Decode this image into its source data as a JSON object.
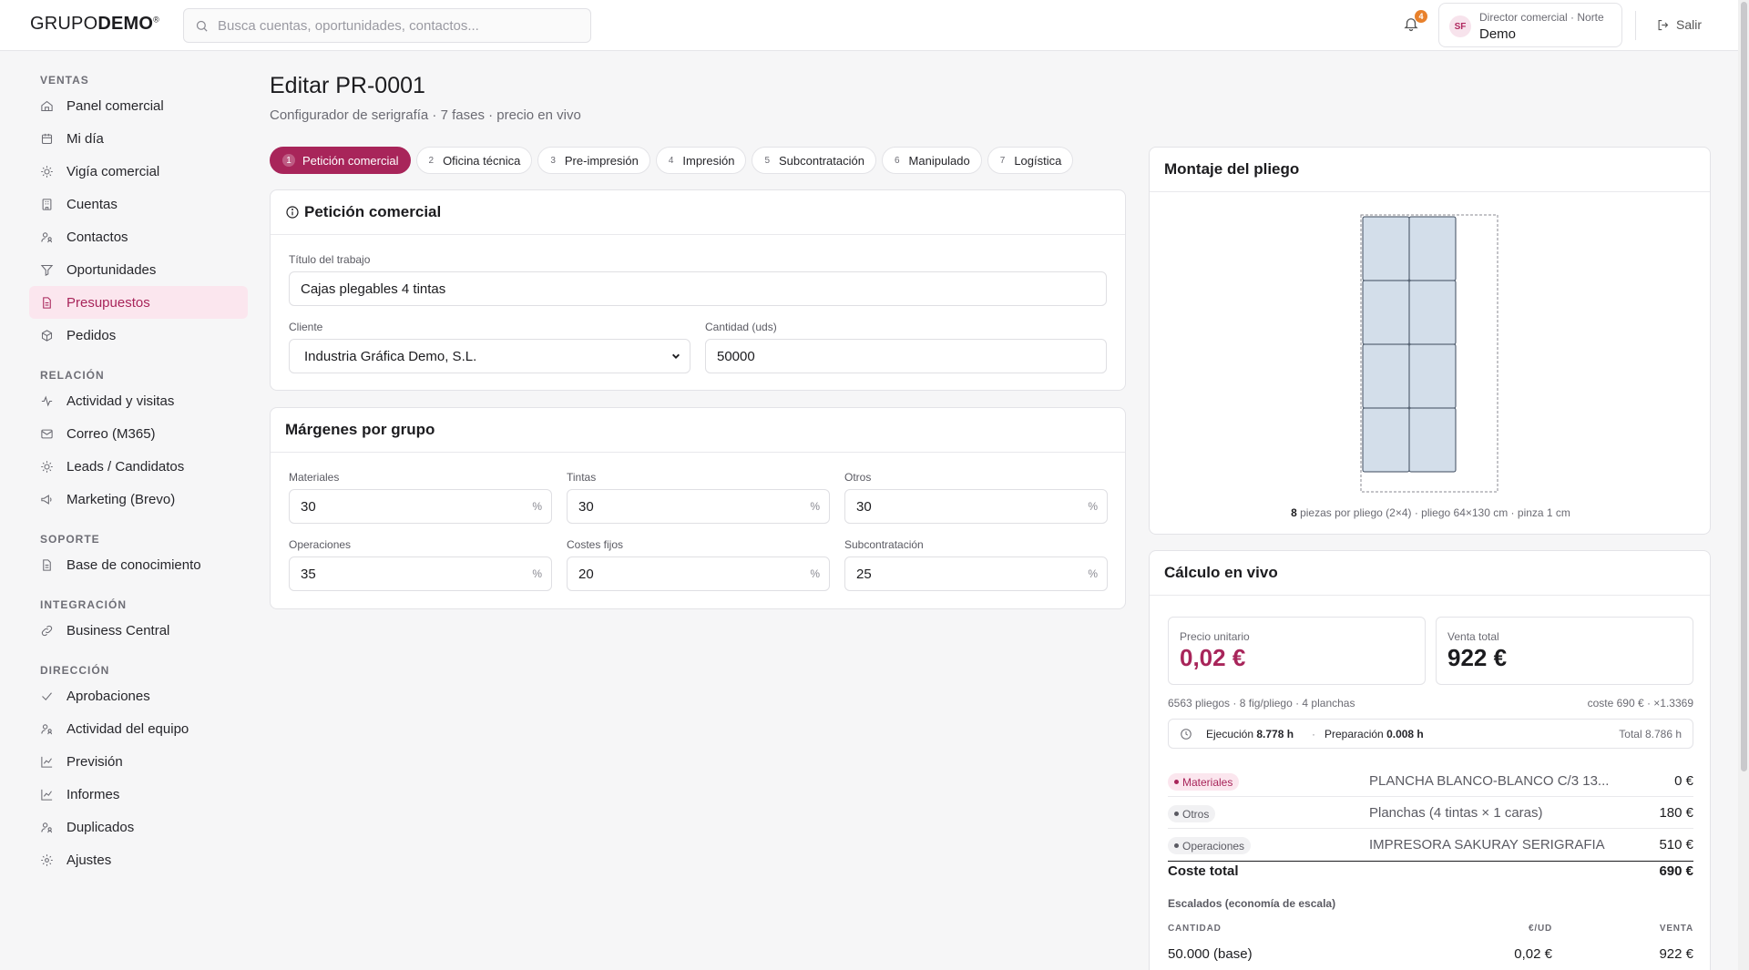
{
  "brand": {
    "logo_light": "GRUPO",
    "logo_bold": "DEMO",
    "logo_mark": "®"
  },
  "search": {
    "placeholder": "Busca cuentas, oportunidades, contactos..."
  },
  "notifications": {
    "count": "4"
  },
  "user": {
    "initials": "SF",
    "role": "Director comercial · Norte",
    "name": "Demo"
  },
  "logout_label": "Salir",
  "sidebar": {
    "sections": [
      {
        "title": "VENTAS",
        "items": [
          {
            "label": "Panel comercial",
            "icon": "home-icon"
          },
          {
            "label": "Mi día",
            "icon": "calendar-icon"
          },
          {
            "label": "Vigía comercial",
            "icon": "sun-icon"
          },
          {
            "label": "Cuentas",
            "icon": "building-icon"
          },
          {
            "label": "Contactos",
            "icon": "contacts-icon"
          },
          {
            "label": "Oportunidades",
            "icon": "funnel-icon"
          },
          {
            "label": "Presupuestos",
            "icon": "document-icon",
            "active": true
          },
          {
            "label": "Pedidos",
            "icon": "box-icon"
          }
        ]
      },
      {
        "title": "RELACIÓN",
        "items": [
          {
            "label": "Actividad y visitas",
            "icon": "activity-icon"
          },
          {
            "label": "Correo (M365)",
            "icon": "mail-icon"
          },
          {
            "label": "Leads / Candidatos",
            "icon": "sun-icon"
          },
          {
            "label": "Marketing (Brevo)",
            "icon": "megaphone-icon"
          }
        ]
      },
      {
        "title": "SOPORTE",
        "items": [
          {
            "label": "Base de conocimiento",
            "icon": "document-icon"
          }
        ]
      },
      {
        "title": "INTEGRACIÓN",
        "items": [
          {
            "label": "Business Central",
            "icon": "link-icon"
          }
        ]
      },
      {
        "title": "DIRECCIÓN",
        "items": [
          {
            "label": "Aprobaciones",
            "icon": "check-icon"
          },
          {
            "label": "Actividad del equipo",
            "icon": "contacts-icon"
          },
          {
            "label": "Previsión",
            "icon": "chart-icon"
          },
          {
            "label": "Informes",
            "icon": "chart-icon"
          },
          {
            "label": "Duplicados",
            "icon": "contacts-icon"
          },
          {
            "label": "Ajustes",
            "icon": "gear-icon"
          }
        ]
      }
    ]
  },
  "page": {
    "title": "Editar PR-0001",
    "subtitle": "Configurador de serigrafía · 7 fases · precio en vivo"
  },
  "steps": [
    {
      "num": "1",
      "label": "Petición comercial",
      "active": true
    },
    {
      "num": "2",
      "label": "Oficina técnica"
    },
    {
      "num": "3",
      "label": "Pre-impresión"
    },
    {
      "num": "4",
      "label": "Impresión"
    },
    {
      "num": "5",
      "label": "Subcontratación"
    },
    {
      "num": "6",
      "label": "Manipulado"
    },
    {
      "num": "7",
      "label": "Logística"
    }
  ],
  "request": {
    "heading": "Petición comercial",
    "title_label": "Título del trabajo",
    "title_value": "Cajas plegables 4 tintas",
    "client_label": "Cliente",
    "client_value": "Industria Gráfica Demo, S.L.",
    "qty_label": "Cantidad (uds)",
    "qty_value": "50000"
  },
  "margins": {
    "heading": "Márgenes por grupo",
    "unit": "%",
    "fields": [
      {
        "label": "Materiales",
        "value": "30"
      },
      {
        "label": "Tintas",
        "value": "30"
      },
      {
        "label": "Otros",
        "value": "30"
      },
      {
        "label": "Operaciones",
        "value": "35"
      },
      {
        "label": "Costes fijos",
        "value": "20"
      },
      {
        "label": "Subcontratación",
        "value": "25"
      }
    ]
  },
  "sheet": {
    "heading": "Montaje del pliego",
    "pieces": "8",
    "caption_rest": " piezas por pliego (2×4) · pliego 64×130 cm · pinza 1 cm",
    "cols": 2,
    "rows": 4,
    "piece_color": "#d3deea",
    "piece_border": "#3c4a5c"
  },
  "calc": {
    "heading": "Cálculo en vivo",
    "unit_price_label": "Precio unitario",
    "unit_price": "0,02 €",
    "total_sale_label": "Venta total",
    "total_sale": "922 €",
    "meta_left": "6563 pliegos · 8 fig/pliego · 4 planchas",
    "meta_right": "coste 690 € · ×1.3369",
    "exec_label": "Ejecución",
    "exec_value": "8.778 h",
    "prep_label": "Preparación",
    "prep_value": "0.008 h",
    "total_time": "Total 8.786 h",
    "rows": [
      {
        "group": "Materiales",
        "desc": "PLANCHA BLANCO-BLANCO C/3 13...",
        "amount": "0 €",
        "color": "#a8255a",
        "bg": "#fbe6ee"
      },
      {
        "group": "Otros",
        "desc": "Planchas (4 tintas × 1 caras)",
        "amount": "180 €",
        "color": "#5a5a62",
        "bg": "#f1f1f3"
      },
      {
        "group": "Operaciones",
        "desc": "IMPRESORA SAKURAY SERIGRAFIA",
        "amount": "510 €",
        "color": "#5a5a62",
        "bg": "#f1f1f3"
      }
    ],
    "total_cost_label": "Coste total",
    "total_cost": "690 €",
    "scale_title": "Escalados (economía de escala)",
    "scale_headers": [
      "CANTIDAD",
      "€/UD",
      "VENTA"
    ],
    "scale_rows": [
      {
        "qty": "50.000 (base)",
        "unit": "0,02 €",
        "sale": "922 €"
      }
    ]
  },
  "colors": {
    "accent": "#a8255a",
    "accent_soft": "#fbe6ee",
    "notification": "#e8812c"
  }
}
